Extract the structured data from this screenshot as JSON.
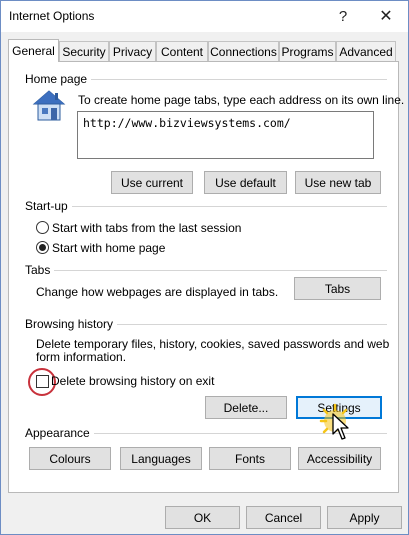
{
  "window": {
    "title": "Internet Options",
    "help_glyph": "?",
    "close_glyph": "✕"
  },
  "tabs": [
    {
      "label": "General"
    },
    {
      "label": "Security"
    },
    {
      "label": "Privacy"
    },
    {
      "label": "Content"
    },
    {
      "label": "Connections"
    },
    {
      "label": "Programs"
    },
    {
      "label": "Advanced"
    }
  ],
  "home_page": {
    "group_label": "Home page",
    "description": "To create home page tabs, type each address on its own line.",
    "url_value": "http://www.bizviewsystems.com/",
    "use_current": "Use current",
    "use_default": "Use default",
    "use_new_tab": "Use new tab"
  },
  "startup": {
    "group_label": "Start-up",
    "option_last_session": "Start with tabs from the last session",
    "option_home_page": "Start with home page",
    "selected": "home_page"
  },
  "tabs_section": {
    "group_label": "Tabs",
    "description": "Change how webpages are displayed in tabs.",
    "button": "Tabs"
  },
  "browsing_history": {
    "group_label": "Browsing history",
    "description_line1": "Delete temporary files, history, cookies, saved passwords and web",
    "description_line2": "form information.",
    "delete_on_exit_label": "Delete browsing history on exit",
    "delete_on_exit_checked": false,
    "delete_button": "Delete...",
    "settings_button": "Settings"
  },
  "appearance": {
    "group_label": "Appearance",
    "colours": "Colours",
    "languages": "Languages",
    "fonts": "Fonts",
    "accessibility": "Accessibility"
  },
  "footer": {
    "ok": "OK",
    "cancel": "Cancel",
    "apply": "Apply"
  },
  "colors": {
    "accent": "#0078d7",
    "highlight_ring": "#c8323c",
    "click_glow": "#f5c518"
  }
}
